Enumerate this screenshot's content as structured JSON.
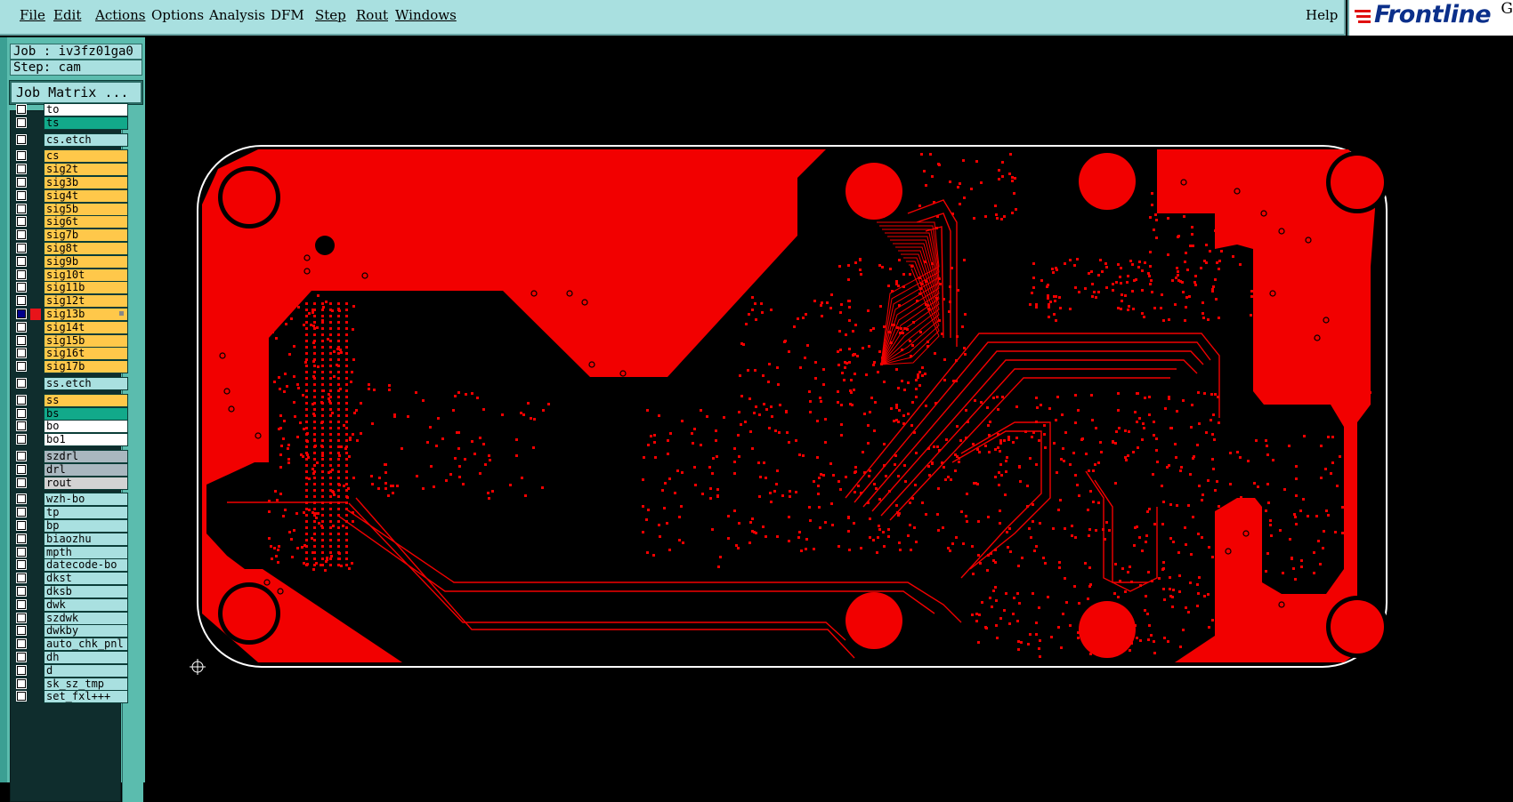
{
  "menu": {
    "file": "File",
    "edit": "Edit",
    "actions": "Actions",
    "options": "Options",
    "analysis": "Analysis",
    "dfm": "DFM",
    "step": "Step",
    "rout": "Rout",
    "windows": "Windows",
    "help": "Help"
  },
  "logo": {
    "text": "Frontline",
    "corner": "G"
  },
  "job": {
    "label": "Job : iv3fz01ga0",
    "step": "Step: cam",
    "matrix_button": "Job Matrix ..."
  },
  "layers": [
    {
      "name": "to",
      "color": "#ffffff",
      "selected": false
    },
    {
      "name": "ts",
      "color": "#12a98a",
      "selected": false
    },
    {
      "name": "cs.etch",
      "color": "#a9e0e0",
      "selected": false
    },
    {
      "name": "cs",
      "color": "#ffc84a",
      "selected": false
    },
    {
      "name": "sig2t",
      "color": "#ffc84a",
      "selected": false
    },
    {
      "name": "sig3b",
      "color": "#ffc84a",
      "selected": false
    },
    {
      "name": "sig4t",
      "color": "#ffc84a",
      "selected": false
    },
    {
      "name": "sig5b",
      "color": "#ffc84a",
      "selected": false
    },
    {
      "name": "sig6t",
      "color": "#ffc84a",
      "selected": false
    },
    {
      "name": "sig7b",
      "color": "#ffc84a",
      "selected": false
    },
    {
      "name": "sig8t",
      "color": "#ffc84a",
      "selected": false
    },
    {
      "name": "sig9b",
      "color": "#ffc84a",
      "selected": false
    },
    {
      "name": "sig10t",
      "color": "#ffc84a",
      "selected": false
    },
    {
      "name": "sig11b",
      "color": "#ffc84a",
      "selected": false
    },
    {
      "name": "sig12t",
      "color": "#ffc84a",
      "selected": false
    },
    {
      "name": "sig13b",
      "color": "#ffc84a",
      "selected": true
    },
    {
      "name": "sig14t",
      "color": "#ffc84a",
      "selected": false
    },
    {
      "name": "sig15b",
      "color": "#ffc84a",
      "selected": false
    },
    {
      "name": "sig16t",
      "color": "#ffc84a",
      "selected": false
    },
    {
      "name": "sig17b",
      "color": "#ffc84a",
      "selected": false
    },
    {
      "name": "ss.etch",
      "color": "#a9e0e0",
      "selected": false
    },
    {
      "name": "ss",
      "color": "#ffc84a",
      "selected": false
    },
    {
      "name": "bs",
      "color": "#12a98a",
      "selected": false
    },
    {
      "name": "bo",
      "color": "#ffffff",
      "selected": false
    },
    {
      "name": "bo1",
      "color": "#ffffff",
      "selected": false
    },
    {
      "name": "szdrl",
      "color": "#a9b7bf",
      "selected": false
    },
    {
      "name": "drl",
      "color": "#a9b7bf",
      "selected": false
    },
    {
      "name": "rout",
      "color": "#d3d3d3",
      "selected": false
    },
    {
      "name": "wzh-bo",
      "color": "#a9e0e0",
      "selected": false
    },
    {
      "name": "tp",
      "color": "#a9e0e0",
      "selected": false
    },
    {
      "name": "bp",
      "color": "#a9e0e0",
      "selected": false
    },
    {
      "name": "biaozhu",
      "color": "#a9e0e0",
      "selected": false
    },
    {
      "name": "mpth",
      "color": "#a9e0e0",
      "selected": false
    },
    {
      "name": "datecode-bo",
      "color": "#a9e0e0",
      "selected": false
    },
    {
      "name": "dkst",
      "color": "#a9e0e0",
      "selected": false
    },
    {
      "name": "dksb",
      "color": "#a9e0e0",
      "selected": false
    },
    {
      "name": "dwk",
      "color": "#a9e0e0",
      "selected": false
    },
    {
      "name": "szdwk",
      "color": "#a9e0e0",
      "selected": false
    },
    {
      "name": "dwkby",
      "color": "#a9e0e0",
      "selected": false
    },
    {
      "name": "auto_chk_pnl",
      "color": "#a9e0e0",
      "selected": false
    },
    {
      "name": "dh",
      "color": "#a9e0e0",
      "selected": false
    },
    {
      "name": "d",
      "color": "#a9e0e0",
      "selected": false
    },
    {
      "name": "sk_sz_tmp",
      "color": "#a9e0e0",
      "selected": false
    },
    {
      "name": "set_fxl+++",
      "color": "#a9e0e0",
      "selected": false
    }
  ],
  "board": {
    "active_layer": "sig13b",
    "feature_color": "#f20000",
    "outline_color": "#ffffff"
  }
}
